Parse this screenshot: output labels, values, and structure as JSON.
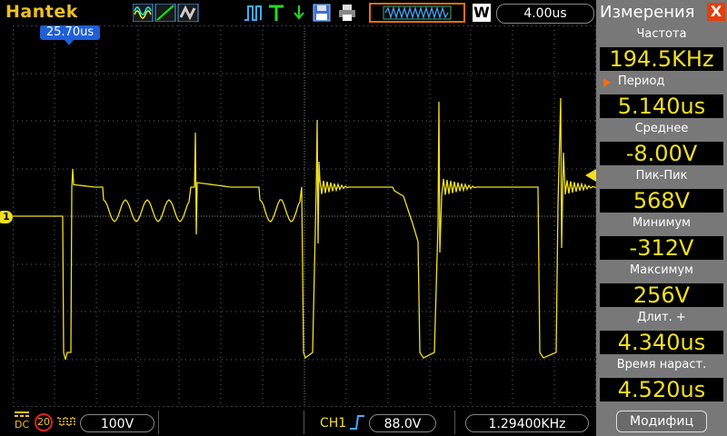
{
  "header": {
    "brand": "Hantek",
    "timebase": "4.00us",
    "window_badge": "W",
    "trigger_position": "25.70us"
  },
  "icons": [
    "waveform-type-icons",
    "run-stop-icon",
    "trigger-T-icon",
    "save-icon",
    "print-icon",
    "waveform-window-icon"
  ],
  "measurements": {
    "title": "Измерения",
    "close": "X",
    "items": [
      {
        "label": "Частота",
        "value": "194.5KHz"
      },
      {
        "label": "Период",
        "value": "5.140us",
        "selected": true
      },
      {
        "label": "Среднее",
        "value": "-8.00V"
      },
      {
        "label": "Пик-Пик",
        "value": "568V"
      },
      {
        "label": "Минимум",
        "value": "-312V"
      },
      {
        "label": "Максимум",
        "value": "256V"
      },
      {
        "label": "Длит.  +",
        "value": "4.340us"
      },
      {
        "label": "Время  нараст.",
        "value": "4.520us"
      }
    ],
    "modify_label": "Модифиц"
  },
  "status": {
    "coupling": "DC",
    "bw_limit": "20",
    "volts_div": "100V",
    "channel": "CH1",
    "trigger_level": "88.0V",
    "trigger_freq": "1.29400KHz"
  },
  "channel_marker": "1",
  "colors": {
    "trace": "#f0e020",
    "accent": "#e07010",
    "panel": "#787878",
    "marker_blue": "#1f5fd6"
  }
}
